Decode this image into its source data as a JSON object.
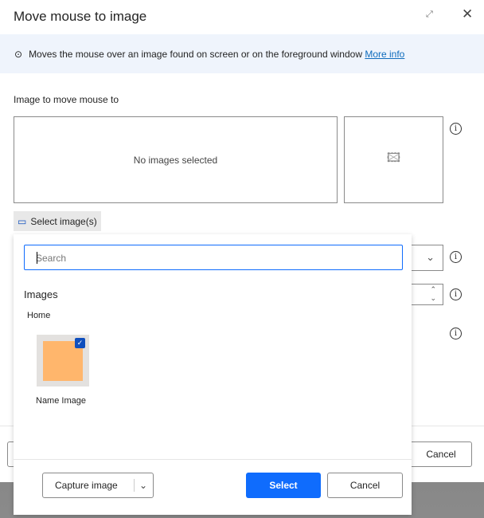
{
  "dialog": {
    "title": "Move mouse to image",
    "description": "Moves the mouse over an image found on screen or on the foreground window",
    "more_info": "More info",
    "image_label": "Image to move mouse to",
    "no_images": "No images selected",
    "select_images": "Select image(s)",
    "cancel": "Cancel"
  },
  "popup": {
    "search_placeholder": "Search",
    "section": "Images",
    "group": "Home",
    "items": [
      {
        "name": "Name Image",
        "checked": true,
        "color": "#ffb66c"
      }
    ],
    "capture": "Capture image",
    "select": "Select",
    "cancel": "Cancel"
  },
  "colors": {
    "accent": "#0f6cfd"
  }
}
